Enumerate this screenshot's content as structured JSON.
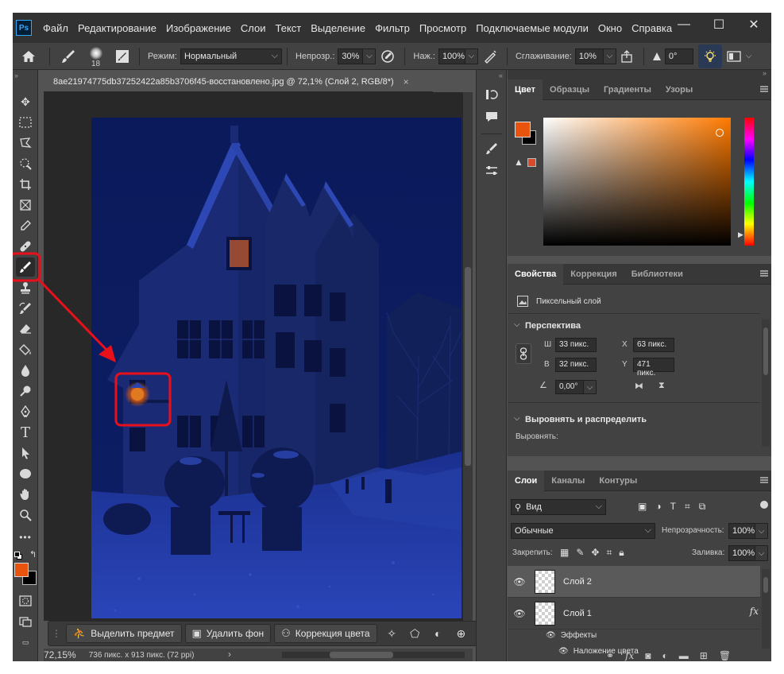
{
  "app": {
    "logo": "Ps",
    "menu": [
      "Файл",
      "Редактирование",
      "Изображение",
      "Слои",
      "Текст",
      "Выделение",
      "Фильтр",
      "Просмотр",
      "Подключаемые модули",
      "Окно",
      "Справка"
    ],
    "window_buttons": [
      "—",
      "☐",
      "✕"
    ]
  },
  "options_bar": {
    "brush_size": "18",
    "mode_label": "Режим:",
    "mode_value": "Нормальный",
    "opacity_label": "Непрозр.:",
    "opacity_value": "30%",
    "flow_label": "Наж.:",
    "flow_value": "100%",
    "smoothing_label": "Сглаживание:",
    "smoothing_value": "10%",
    "angle_value": "0°"
  },
  "document": {
    "tab_title": "8ae21974775db37252422a85b3706f45-восстановлено.jpg @ 72,1% (Слой 2, RGB/8*)",
    "tab_close": "×"
  },
  "context_bar": {
    "select_subject": "Выделить предмет",
    "remove_bg": "Удалить фон",
    "color_correction": "Коррекция цвета",
    "more": "•••"
  },
  "status_bar": {
    "zoom": "72,15%",
    "doc_info": "736 пикс. x 913 пикс. (72 ppi)",
    "arrow": "›"
  },
  "color_panel": {
    "tabs": [
      "Цвет",
      "Образцы",
      "Градиенты",
      "Узоры"
    ],
    "foreground": "#e8530e",
    "background": "#000000",
    "hue_base": "#ff7a00"
  },
  "properties_panel": {
    "tabs": [
      "Свойства",
      "Коррекция",
      "Библиотеки"
    ],
    "layer_type": "Пиксельный слой",
    "transform_title": "Перспектива",
    "w_label": "Ш",
    "w_value": "33 пикс.",
    "h_label": "В",
    "h_value": "32 пикс.",
    "x_label": "X",
    "x_value": "63 пикс.",
    "y_label": "Y",
    "y_value": "471 пикс.",
    "angle_value": "0,00°",
    "align_title": "Выровнять и распределить",
    "align_label": "Выровнять:"
  },
  "layers_panel": {
    "tabs": [
      "Слои",
      "Каналы",
      "Контуры"
    ],
    "filter_label": "Вид",
    "blend_mode": "Обычные",
    "opacity_label": "Непрозрачность:",
    "opacity_value": "100%",
    "lock_label": "Закрепить:",
    "fill_label": "Заливка:",
    "fill_value": "100%",
    "layers": [
      {
        "name": "Слой 2",
        "selected": true
      },
      {
        "name": "Слой 1",
        "selected": false,
        "fx": "fx"
      }
    ],
    "effects_label": "Эффекты",
    "effect_item": "Наложение цвета"
  },
  "annotation_color": "#e8101a"
}
